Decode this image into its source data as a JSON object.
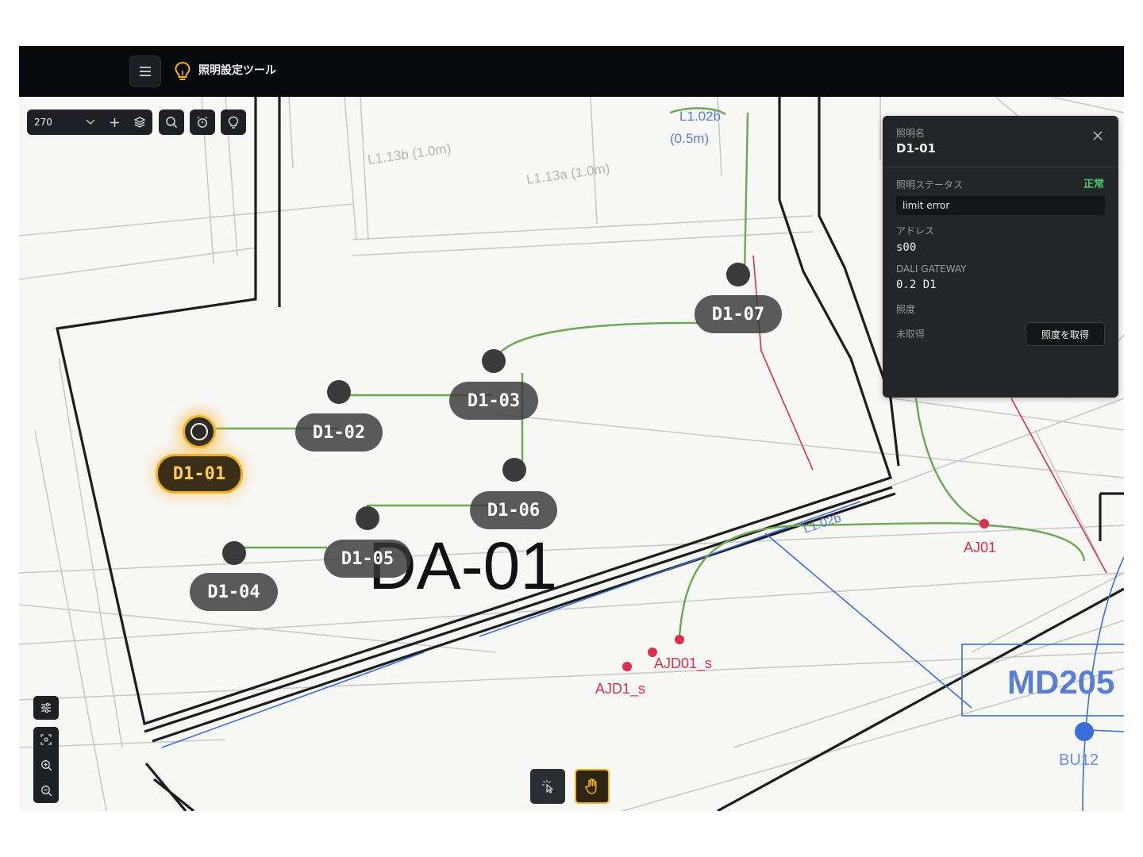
{
  "app": {
    "title": "照明設定ツール"
  },
  "toolbar": {
    "zoom_value": "270"
  },
  "lights": [
    {
      "name": "D1-01",
      "selected": true
    },
    {
      "name": "D1-02",
      "selected": false
    },
    {
      "name": "D1-03",
      "selected": false
    },
    {
      "name": "D1-04",
      "selected": false
    },
    {
      "name": "D1-05",
      "selected": false
    },
    {
      "name": "D1-06",
      "selected": false
    },
    {
      "name": "D1-07",
      "selected": false
    }
  ],
  "drawing_labels": {
    "area": "DA-01",
    "room": "MD205",
    "bu": "BU12",
    "aj01": "AJ01",
    "ajd01_s": "AJD01_s",
    "ajd01_s2": "AJD1_s",
    "l13b": "L1.13b (1.0m)",
    "l13a": "L1.13a (1.0m)",
    "l02b_top": "L1.02b",
    "l02b_top_len": "(0.5m)",
    "l02b_mid": "L1.02b"
  },
  "panel": {
    "name_label": "照明名",
    "name_value": "D1-01",
    "status_label": "照明ステータス",
    "status_value": "正常",
    "error_text": "limit error",
    "address_label": "アドレス",
    "address_value": "s00",
    "gateway_label": "DALI GATEWAY",
    "gateway_value": "0.2 D1",
    "illuminance_label": "照度",
    "illuminance_value": "未取得",
    "fetch_button": "照度を取得"
  },
  "colors": {
    "accent": "#f3b11f",
    "ok": "#47c96a",
    "wire": "#6ba84f",
    "red": "#d9304c",
    "blue": "#3a6fd8"
  },
  "icons": [
    "menu-icon",
    "lightbulb-icon",
    "chevron-down-icon",
    "plus-icon",
    "layers-icon",
    "search-icon",
    "alarm-icon",
    "lightbulb-icon",
    "close-icon",
    "sliders-icon",
    "focus-icon",
    "zoom-in-icon",
    "zoom-out-icon",
    "pointer-icon",
    "hand-icon"
  ]
}
